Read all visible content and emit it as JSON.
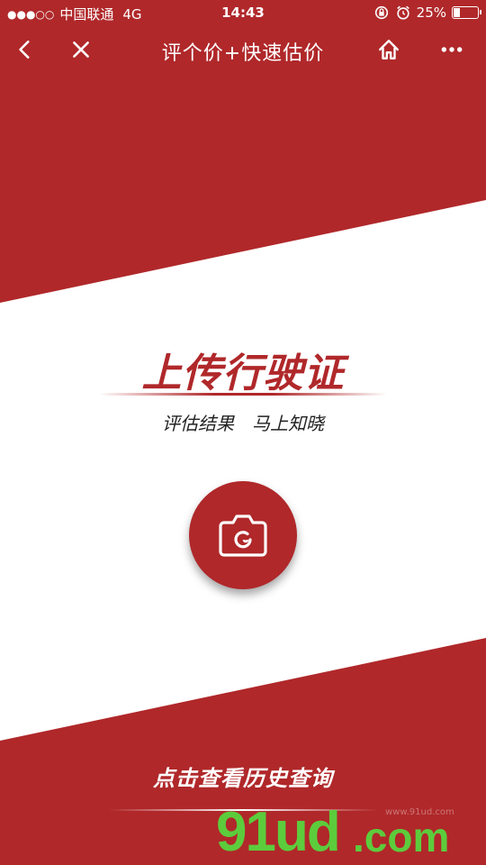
{
  "status_bar": {
    "signal": "●●●○○",
    "carrier": "中国联通",
    "network": "4G",
    "time": "14:43",
    "battery_text": "25%",
    "battery_level": 0.25
  },
  "nav": {
    "title": "评个价+快速估价"
  },
  "main": {
    "headline": "上传行驶证",
    "subtitle_part1": "评估结果",
    "subtitle_part2": "马上知晓",
    "history_link": "点击查看历史查询"
  },
  "watermark": {
    "main": "91ud",
    "suffix": ".com",
    "small": "www.91ud.com"
  },
  "colors": {
    "brand_red": "#b0282a",
    "white": "#ffffff",
    "watermark_green": "#5ccc3c"
  },
  "icons": {
    "back": "chevron-left-icon",
    "close": "close-icon",
    "home": "home-icon",
    "more": "more-dots-icon",
    "camera": "camera-icon",
    "rotation_lock": "rotation-lock-icon",
    "alarm": "alarm-icon"
  }
}
